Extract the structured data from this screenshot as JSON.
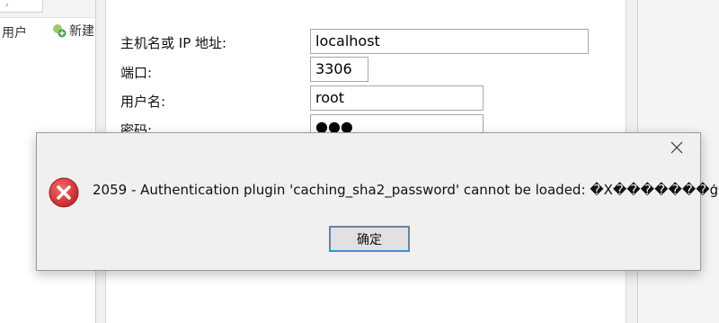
{
  "background_app": {
    "toolbar": {
      "user_label": "用户",
      "new_label": "新建"
    }
  },
  "connection_form": {
    "host": {
      "label": "主机名或 IP 地址:",
      "value": "localhost"
    },
    "port": {
      "label": "端口:",
      "value": "3306"
    },
    "username": {
      "label": "用户名:",
      "value": "root"
    },
    "password": {
      "label": "密码:",
      "value": "●●●"
    }
  },
  "error_dialog": {
    "message": "2059 - Authentication plugin 'caching_sha2_password' cannot be loaded: �X�������ģ�顣",
    "ok_label": "确定",
    "close_icon": "close-icon",
    "error_icon": "error-icon"
  },
  "colors": {
    "error_red": "#d32f2f",
    "accent_blue": "#3c8ed8",
    "dialog_bg": "#f0f0f0"
  }
}
